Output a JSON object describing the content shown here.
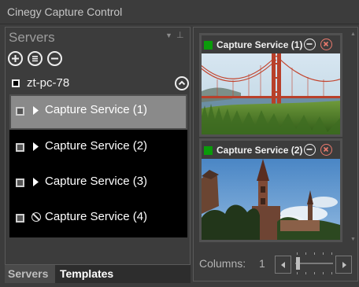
{
  "window": {
    "title": "Cinegy Capture Control"
  },
  "servers_panel": {
    "title": "Servers",
    "toolbar_icons": [
      "add-circle-icon",
      "list-circle-icon",
      "remove-circle-icon"
    ],
    "host": {
      "name": "zt-pc-78"
    },
    "services": [
      {
        "label": "Capture Service (1)",
        "state": "play",
        "selected": true
      },
      {
        "label": "Capture Service (2)",
        "state": "play",
        "selected": false
      },
      {
        "label": "Capture Service (3)",
        "state": "play",
        "selected": false
      },
      {
        "label": "Capture Service (4)",
        "state": "disabled",
        "selected": false
      }
    ]
  },
  "tabs": {
    "servers": "Servers",
    "templates": "Templates"
  },
  "previews": [
    {
      "title": "Capture Service (1)",
      "status_color": "#0a9b0a",
      "image": "golden-gate-bridge"
    },
    {
      "title": "Capture Service (2)",
      "status_color": "#0a9b0a",
      "image": "church-tower"
    }
  ],
  "columns": {
    "label": "Columns:",
    "value": "1"
  },
  "colors": {
    "background": "#3c3c3c",
    "list_bg": "#000000",
    "selected_row": "#8a8a8a",
    "close_red": "#ea7a6d",
    "status_green": "#0a9b0a"
  }
}
